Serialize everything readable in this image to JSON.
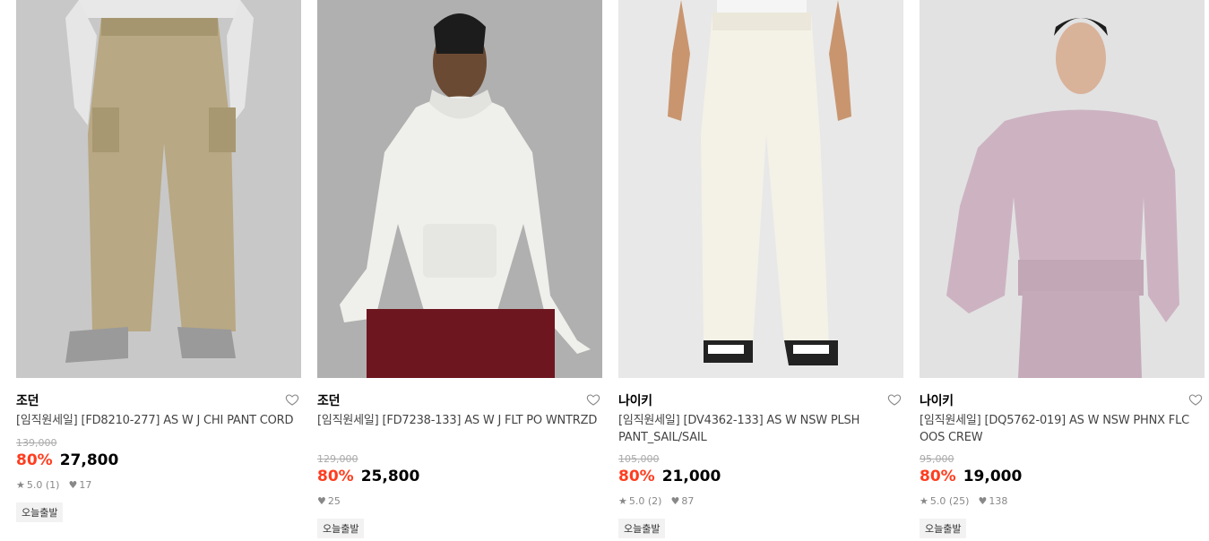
{
  "products": [
    {
      "brand": "조던",
      "name": "[임직원세일] [FD8210-277] AS W J CHI PANT CORD",
      "original_price": "139,000",
      "discount": "80%",
      "price": "27,800",
      "rating": "5.0 (1)",
      "likes": "17",
      "tag": "오늘출발",
      "image": "khaki-cargo-pants-photo"
    },
    {
      "brand": "조던",
      "name": "[임직원세일] [FD7238-133] AS W J FLT PO WNTRZD",
      "original_price": "129,000",
      "discount": "80%",
      "price": "25,800",
      "rating": "",
      "likes": "25",
      "tag": "오늘출발",
      "image": "white-hoodie-photo"
    },
    {
      "brand": "나이키",
      "name": "[임직원세일] [DV4362-133] AS W NSW PLSH PANT_SAIL/SAIL",
      "original_price": "105,000",
      "discount": "80%",
      "price": "21,000",
      "rating": "5.0 (2)",
      "likes": "87",
      "tag": "오늘출발",
      "image": "sail-wide-pants-photo"
    },
    {
      "brand": "나이키",
      "name": "[임직원세일] [DQ5762-019] AS W NSW PHNX FLC OOS CREW",
      "original_price": "95,000",
      "discount": "80%",
      "price": "19,000",
      "rating": "5.0 (25)",
      "likes": "138",
      "tag": "오늘출발",
      "image": "mauve-crew-sweatshirt-photo"
    }
  ],
  "colors": {
    "discount": "#ff3d1f",
    "image_bg": "#d4d4d4"
  }
}
